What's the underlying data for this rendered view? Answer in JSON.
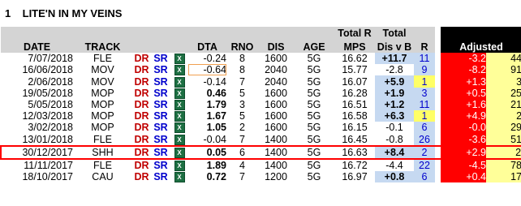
{
  "horse": {
    "number": "1",
    "name": "LITE'N IN MY VEINS"
  },
  "headers": {
    "date": "DATE",
    "track": "TRACK",
    "dta": "DTA",
    "rno": "RNO",
    "dis": "DIS",
    "age": "AGE",
    "total_r_top": "Total R",
    "total_r_bottom": "MPS",
    "total_dis_top": "Total",
    "total_dis_bottom": "Dis v B",
    "r": "R",
    "adjusted": "Adjusted"
  },
  "links": {
    "dr": "DR",
    "sr": "SR",
    "excel_icon": "X"
  },
  "rows": [
    {
      "date": "7/07/2018",
      "track": "FLE",
      "dta": "-0.24",
      "rno": "8",
      "dis": "1600",
      "age": "5G",
      "mps": "16.62",
      "disvb": "+11.7",
      "r": "11",
      "adj": "-3.2",
      "adj_r": "44"
    },
    {
      "date": "16/06/2018",
      "track": "MOV",
      "dta": "-0.64",
      "rno": "8",
      "dis": "2040",
      "age": "5G",
      "mps": "15.77",
      "disvb": "-2.8",
      "r": "9",
      "adj": "-8.2",
      "adj_r": "91"
    },
    {
      "date": "2/06/2018",
      "track": "MOV",
      "dta": "-0.14",
      "rno": "7",
      "dis": "2040",
      "age": "5G",
      "mps": "16.07",
      "disvb": "+5.9",
      "r": "1",
      "adj": "+1.3",
      "adj_r": "3"
    },
    {
      "date": "19/05/2018",
      "track": "MOP",
      "dta": "0.46",
      "rno": "5",
      "dis": "1600",
      "age": "5G",
      "mps": "16.28",
      "disvb": "+1.9",
      "r": "3",
      "adj": "+0.5",
      "adj_r": "25"
    },
    {
      "date": "5/05/2018",
      "track": "MOP",
      "dta": "1.79",
      "rno": "3",
      "dis": "1600",
      "age": "5G",
      "mps": "16.51",
      "disvb": "+1.2",
      "r": "11",
      "adj": "+1.6",
      "adj_r": "21"
    },
    {
      "date": "12/03/2018",
      "track": "MOP",
      "dta": "1.67",
      "rno": "5",
      "dis": "1600",
      "age": "5G",
      "mps": "16.58",
      "disvb": "+6.3",
      "r": "1",
      "adj": "+4.9",
      "adj_r": "2"
    },
    {
      "date": "3/02/2018",
      "track": "MOP",
      "dta": "1.05",
      "rno": "2",
      "dis": "1600",
      "age": "5G",
      "mps": "16.15",
      "disvb": "-0.1",
      "r": "6",
      "adj": "-0.0",
      "adj_r": "29"
    },
    {
      "date": "13/01/2018",
      "track": "FLE",
      "dta": "-0.04",
      "rno": "7",
      "dis": "1400",
      "age": "5G",
      "mps": "16.45",
      "disvb": "-0.8",
      "r": "26",
      "adj": "-3.6",
      "adj_r": "51"
    },
    {
      "date": "30/12/2017",
      "track": "SHH",
      "dta": "0.05",
      "rno": "6",
      "dis": "1400",
      "age": "5G",
      "mps": "16.63",
      "disvb": "+8.4",
      "r": "2",
      "adj": "+2.9",
      "adj_r": "2"
    },
    {
      "date": "11/11/2017",
      "track": "FLE",
      "dta": "1.89",
      "rno": "4",
      "dis": "1400",
      "age": "5G",
      "mps": "16.72",
      "disvb": "-4.4",
      "r": "22",
      "adj": "-4.5",
      "adj_r": "78"
    },
    {
      "date": "18/10/2017",
      "track": "CAU",
      "dta": "0.72",
      "rno": "7",
      "dis": "1200",
      "age": "5G",
      "mps": "16.97",
      "disvb": "+0.8",
      "r": "6",
      "adj": "+0.4",
      "adj_r": "17"
    }
  ],
  "colors": {
    "dr": "#c00000",
    "sr": "#0000cc",
    "adjusted_bg": "#ff0000",
    "highlight": "#ff0000",
    "rank_yellow": "#ffff66",
    "rank_blue": "#c6d9f1"
  }
}
